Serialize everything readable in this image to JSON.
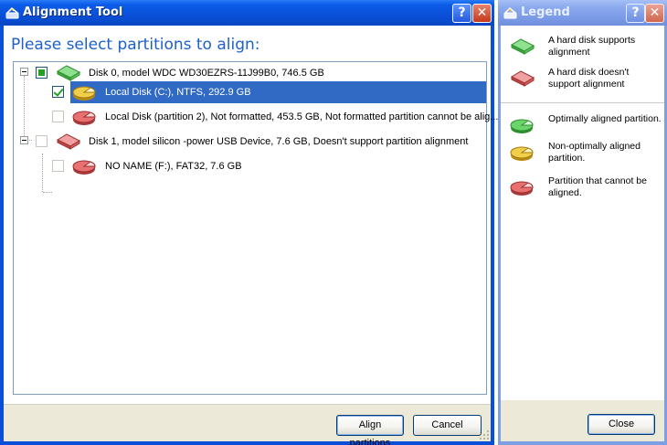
{
  "main_window": {
    "title": "Alignment Tool",
    "help_button": "?",
    "close_button": "✕",
    "heading": "Please select partitions to align:",
    "tree": [
      {
        "label": "Disk 0, model WDC WD30EZRS-11J99B0, 746.5 GB",
        "level": 0,
        "checkbox": "partial",
        "expander": "minus",
        "icon": "green-disk-icon"
      },
      {
        "label": "Local Disk (C:), NTFS, 292.9 GB",
        "level": 1,
        "checkbox": "checked",
        "selected": true,
        "icon": "yellow-partition-icon"
      },
      {
        "label": "Local Disk (partition 2), Not formatted, 453.5 GB, Not formatted partition cannot be alig...",
        "level": 1,
        "checkbox": "disabled",
        "icon": "red-partition-icon"
      },
      {
        "label": "Disk 1, model silicon -power USB Device, 7.6 GB, Doesn't support partition alignment",
        "level": 0,
        "checkbox": "disabled",
        "expander": "minus",
        "icon": "red-disk-icon"
      },
      {
        "label": "NO NAME (F:), FAT32, 7.6 GB",
        "level": 1,
        "checkbox": "disabled",
        "icon": "red-partition-icon"
      }
    ],
    "buttons": {
      "align": "Align partitions",
      "cancel": "Cancel"
    }
  },
  "legend_window": {
    "title": "Legend",
    "help_button": "?",
    "close_button": "✕",
    "items": [
      {
        "icon": "green-disk-icon",
        "text": "A hard disk supports alignment"
      },
      {
        "icon": "red-disk-icon",
        "text": "A hard disk doesn't support alignment"
      },
      {
        "icon": "green-partition-icon",
        "text": "Optimally aligned partition."
      },
      {
        "icon": "yellow-partition-icon",
        "text": "Non-optimally aligned partition."
      },
      {
        "icon": "red-partition-icon",
        "text": "Partition that cannot be aligned."
      }
    ],
    "close_label": "Close"
  },
  "colors": {
    "heading": "#1c60c8",
    "selection": "#316ac5",
    "title_bar_active": "#0a50d8",
    "title_bar_inactive": "#7c9be6"
  }
}
